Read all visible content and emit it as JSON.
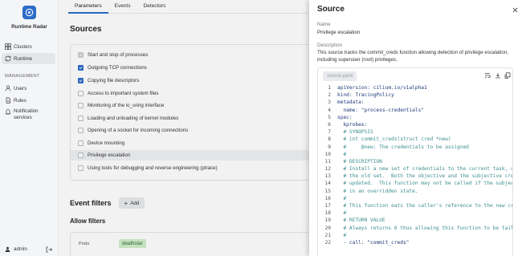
{
  "app": {
    "name": "Runtime Radar"
  },
  "sidebar": {
    "items": [
      {
        "label": "Clusters",
        "icon": "clusters-icon"
      },
      {
        "label": "Runtime",
        "icon": "runtime-icon",
        "active": true
      }
    ],
    "management_label": "MANAGEMENT",
    "management_items": [
      {
        "label": "Users",
        "icon": "users-icon"
      },
      {
        "label": "Rules",
        "icon": "rules-icon"
      },
      {
        "label": "Notification services",
        "icon": "notification-icon"
      }
    ],
    "user": "admin"
  },
  "tabs": [
    "Parameters",
    "Events",
    "Detectors"
  ],
  "sources": {
    "title": "Sources",
    "items": [
      {
        "label": "Start and stop of processes",
        "state": "disabled"
      },
      {
        "label": "Outgoing TCP connections",
        "state": "checked"
      },
      {
        "label": "Copying file descriptors",
        "state": "checked"
      },
      {
        "label": "Access to important system files",
        "state": "unchecked"
      },
      {
        "label": "Monitoring of the io_uring interface",
        "state": "unchecked"
      },
      {
        "label": "Loading and unloading of kernel modules",
        "state": "unchecked"
      },
      {
        "label": "Opening of a socket for incoming connections",
        "state": "unchecked"
      },
      {
        "label": "Device mounting",
        "state": "unchecked"
      },
      {
        "label": "Privilege escalation",
        "state": "unchecked",
        "highlighted": true
      },
      {
        "label": "Using tools for debugging and reverse engineering (ptrace)",
        "state": "unchecked"
      }
    ]
  },
  "event_filters": {
    "title": "Event filters",
    "add_label": "Add",
    "allow_title": "Allow filters",
    "pods_label": "Pods",
    "pods_tag": "deathstar"
  },
  "drawer": {
    "title": "Source",
    "name_label": "Name",
    "name_value": "Privilege escalation",
    "description_label": "Description",
    "description_value": "This source tracks the commit_creds function allowing detection of privilege escalation, including superuser (root) privileges.",
    "file_name": "source.yaml",
    "code_lines": [
      {
        "n": "1",
        "t": "apiVersion: cilium.io/v1alpha1",
        "c": false
      },
      {
        "n": "2",
        "t": "kind: TracingPolicy",
        "c": false
      },
      {
        "n": "3",
        "t": "metadata:",
        "c": false
      },
      {
        "n": "4",
        "t": "  name: \"process-credentials\"",
        "c": false
      },
      {
        "n": "5",
        "t": "spec:",
        "c": false
      },
      {
        "n": "6",
        "t": "  kprobes:",
        "c": false
      },
      {
        "n": "7",
        "t": "  # SYNOPSIS",
        "c": true
      },
      {
        "n": "8",
        "t": "  # int commit_creds(struct cred *new)",
        "c": true
      },
      {
        "n": "9",
        "t": "  #     @new: The credentials to be assigned",
        "c": true
      },
      {
        "n": "10",
        "t": "  #",
        "c": true
      },
      {
        "n": "11",
        "t": "  # DESCRIPTION",
        "c": true
      },
      {
        "n": "12",
        "t": "  # Install a new set of credentials to the current task, us",
        "c": true
      },
      {
        "n": "13",
        "t": "  # the old set.  Both the objective and the subjective cred",
        "c": true
      },
      {
        "n": "14",
        "t": "  # updated.  This function may not be called if the subject",
        "c": true
      },
      {
        "n": "15",
        "t": "  # in an overridden state.",
        "c": true
      },
      {
        "n": "16",
        "t": "  #",
        "c": true
      },
      {
        "n": "17",
        "t": "  # This function eats the caller's reference to the new cre",
        "c": true
      },
      {
        "n": "18",
        "t": "  #",
        "c": true
      },
      {
        "n": "19",
        "t": "  # RETURN VALUE",
        "c": true
      },
      {
        "n": "20",
        "t": "  # Always returns 0 thus allowing this function to be tail-",
        "c": true
      },
      {
        "n": "21",
        "t": "  #",
        "c": true
      },
      {
        "n": "22",
        "t": "  - call: \"commit_creds\"",
        "c": false
      }
    ]
  },
  "colors": {
    "accent": "#2d6cc8",
    "tag_bg": "#cfeec9",
    "comment": "#3f8f8f"
  }
}
